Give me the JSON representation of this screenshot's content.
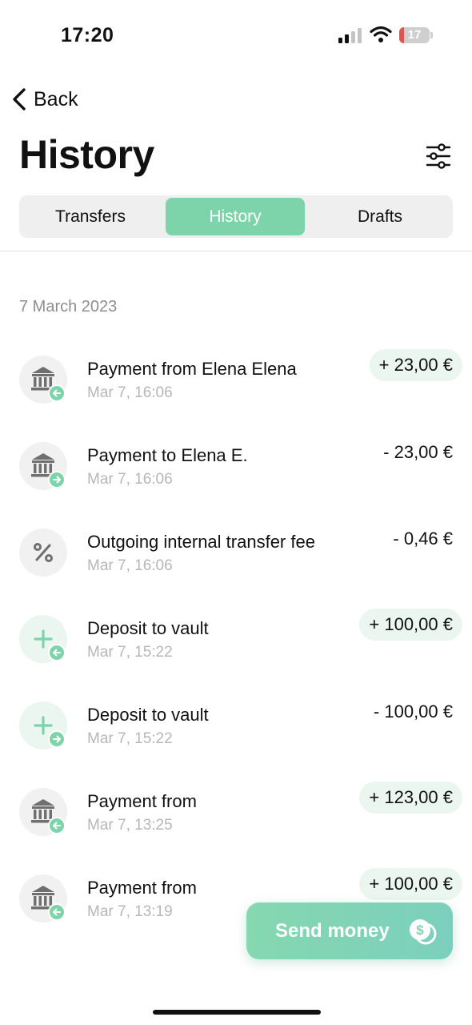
{
  "status_bar": {
    "time": "17:20",
    "battery": "17",
    "battery_level_percent": 17
  },
  "nav": {
    "back_label": "Back"
  },
  "header": {
    "title": "History"
  },
  "tabs": [
    {
      "label": "Transfers",
      "active": false
    },
    {
      "label": "History",
      "active": true
    },
    {
      "label": "Drafts",
      "active": false
    }
  ],
  "date_group": "7 March 2023",
  "transactions": [
    {
      "icon": "bank-icon",
      "direction": "incoming",
      "title": "Payment from Elena Elena",
      "time": "Mar 7, 16:06",
      "amount": "+ 23,00 €"
    },
    {
      "icon": "bank-icon",
      "direction": "outgoing",
      "title": "Payment to Elena E.",
      "time": "Mar 7, 16:06",
      "amount": "- 23,00 €"
    },
    {
      "icon": "percent-icon",
      "direction": "none",
      "title": "Outgoing internal transfer fee",
      "time": "Mar 7, 16:06",
      "amount": "- 0,46 €"
    },
    {
      "icon": "plus-icon",
      "direction": "incoming",
      "title": "Deposit to vault",
      "time": "Mar 7, 15:22",
      "amount": "+ 100,00 €"
    },
    {
      "icon": "plus-icon",
      "direction": "outgoing",
      "title": "Deposit to vault",
      "time": "Mar 7, 15:22",
      "amount": "- 100,00 €"
    },
    {
      "icon": "bank-icon",
      "direction": "incoming",
      "title": "Payment from",
      "time": "Mar 7, 13:25",
      "amount": "+ 123,00 €"
    },
    {
      "icon": "bank-icon",
      "direction": "incoming",
      "title": "Payment from",
      "time": "Mar 7, 13:19",
      "amount": "+ 100,00 €"
    }
  ],
  "send_button": {
    "label": "Send money",
    "icon": "coins-icon"
  },
  "colors": {
    "accent": "#7ed4aa",
    "incoming_bg": "#eaf6ef",
    "muted": "#b7b7b7",
    "battery_low": "#e0564a"
  }
}
